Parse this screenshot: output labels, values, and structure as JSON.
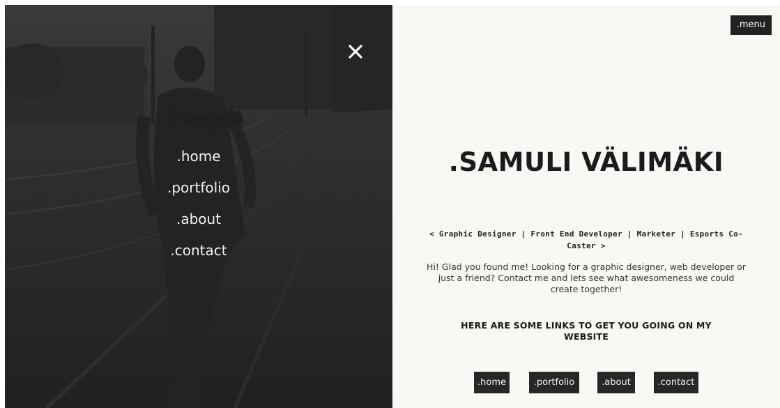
{
  "overlay_menu": {
    "items": [
      {
        "label": ".home"
      },
      {
        "label": ".portfolio"
      },
      {
        "label": ".about"
      },
      {
        "label": ".contact"
      }
    ],
    "close_icon": "close-icon"
  },
  "header": {
    "menu_label": ".menu"
  },
  "main": {
    "title": ".SAMULI VÄLIMÄKI",
    "tagline": "< Graphic Designer | Front End Developer | Marketer | Esports Co-Caster >",
    "intro": "Hi! Glad you found me! Looking for a graphic designer, web developer or just a friend? Contact me and lets see what awesomeness we could create together!",
    "links_heading": "HERE ARE SOME LINKS TO GET YOU GOING ON MY WEBSITE",
    "links": [
      {
        "label": ".home"
      },
      {
        "label": ".portfolio"
      },
      {
        "label": ".about"
      },
      {
        "label": ".contact"
      }
    ]
  },
  "colors": {
    "background": "#f8f8f4",
    "button": "#272727",
    "text": "#1b1b1b"
  }
}
